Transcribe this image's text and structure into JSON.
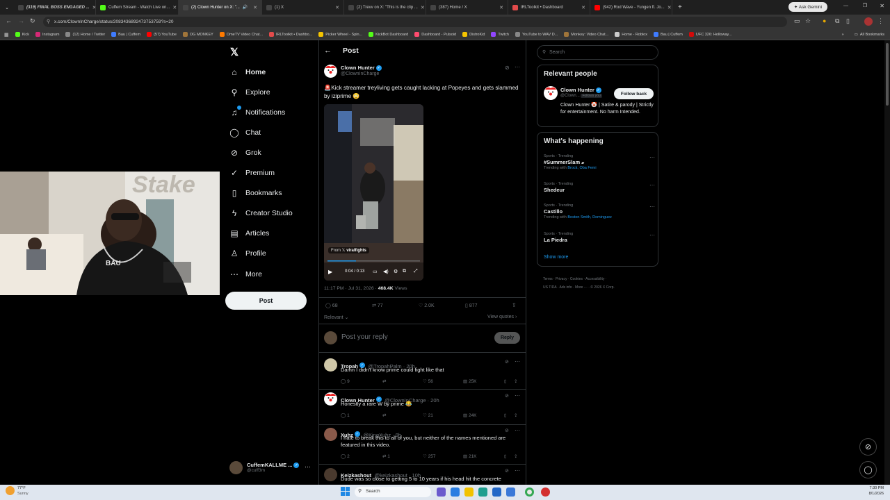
{
  "browser": {
    "tabs": [
      {
        "title": "(319) FINAL BOSS ENGAGED ...",
        "color": "#444"
      },
      {
        "title": "Cuffem Stream - Watch Live on...",
        "color": "#53fc18"
      },
      {
        "title": "(2) Clown Hunter on X: \"...",
        "color": "#444"
      },
      {
        "title": "(1) X",
        "color": "#444"
      },
      {
        "title": "(2) Trevv on X: \"This is the clip ...",
        "color": "#444"
      },
      {
        "title": "(387) Home / X",
        "color": "#444"
      },
      {
        "title": "IRLToolkit • Dashboard",
        "color": "#e34b4b"
      },
      {
        "title": "(942) Rod Wave - Yungen ft. Jo...",
        "color": "#ff0000"
      }
    ],
    "url": "x.com/ClownInCharge/status/2083436892473753759?s=20",
    "ask_gemini": "Ask Gemini",
    "bookmarks": [
      {
        "label": "Kick",
        "color": "#53fc18"
      },
      {
        "label": "Instagram",
        "color": "#d62976"
      },
      {
        "label": "(12) Home / Twitter",
        "color": "#888"
      },
      {
        "label": "Bau | Cuffem",
        "color": "#3f7cff"
      },
      {
        "label": "(57) YouTube",
        "color": "#ff0000"
      },
      {
        "label": "OG MONKEY",
        "color": "#a0753a"
      },
      {
        "label": "OmeTV Video Chat...",
        "color": "#ff7a00"
      },
      {
        "label": "IRLToolkit • Dashbo...",
        "color": "#e34b4b"
      },
      {
        "label": "Picker Wheel - Spin...",
        "color": "#f5c400"
      },
      {
        "label": "KickBot Dashboard",
        "color": "#53fc18"
      },
      {
        "label": "Dashboard - Pulsoid",
        "color": "#ff4b6e"
      },
      {
        "label": "DistroKid",
        "color": "#f5c400"
      },
      {
        "label": "Twitch",
        "color": "#9146ff"
      },
      {
        "label": "YouTube to WAV D...",
        "color": "#888"
      },
      {
        "label": "Monkey: Video Chat...",
        "color": "#a0753a"
      },
      {
        "label": "Home - Roblox",
        "color": "#ccc"
      },
      {
        "label": "Bau | Cuffem",
        "color": "#3f7cff"
      },
      {
        "label": "UFC 326: Holloway...",
        "color": "#d20a0a"
      }
    ],
    "all_bookmarks": "All Bookmarks"
  },
  "nav": {
    "items": [
      {
        "label": "Home",
        "icon": "home-icon"
      },
      {
        "label": "Explore",
        "icon": "search-icon"
      },
      {
        "label": "Notifications",
        "icon": "bell-icon"
      },
      {
        "label": "Chat",
        "icon": "chat-icon"
      },
      {
        "label": "Grok",
        "icon": "grok-icon"
      },
      {
        "label": "Premium",
        "icon": "premium-icon"
      },
      {
        "label": "Bookmarks",
        "icon": "bookmark-icon"
      },
      {
        "label": "Creator Studio",
        "icon": "lightning-icon"
      },
      {
        "label": "Articles",
        "icon": "article-icon"
      },
      {
        "label": "Profile",
        "icon": "person-icon"
      },
      {
        "label": "More",
        "icon": "more-icon"
      }
    ],
    "post_button": "Post",
    "account_name": "CuffemKALLME ...",
    "account_handle": "@cuff3m"
  },
  "post": {
    "header": "Post",
    "author_name": "Clown Hunter",
    "author_handle": "@ClownInCharge",
    "text": "🚨Kick streamer treyliving gets caught lacking at Popeyes and gets slammed by iziprime 😳",
    "video_source_prefix": "From",
    "video_source": "viralfights",
    "video_time": "0:04 / 0:13",
    "timestamp": "11:17 PM · Jul 31, 2026 ·",
    "views_count": "468.4K",
    "views_label": "Views",
    "replies": "68",
    "reposts": "77",
    "likes": "2.0K",
    "bookmarks": "877",
    "sort_label": "Relevant",
    "view_quotes": "View quotes",
    "reply_placeholder": "Post your reply",
    "reply_button": "Reply"
  },
  "replies": [
    {
      "name": "Tropah",
      "handle": "@TropahPalm · 20h",
      "text": "Damn I didn't know prime could fight like that",
      "replies": "9",
      "reposts": "",
      "likes": "56",
      "views": "25K"
    },
    {
      "name": "Clown Hunter",
      "handle": "@ClownInCharge · 20h",
      "text": "Honestly a rare W by prime 😂",
      "replies": "1",
      "reposts": "",
      "likes": "21",
      "views": "24K"
    },
    {
      "name": "Xuhz",
      "handle": "@KingXuhz · 9h",
      "text": "I hate to break this to all of you, but neither of the names mentioned are featured in this video.",
      "replies": "2",
      "reposts": "1",
      "likes": "257",
      "views": "21K"
    },
    {
      "name": "Keizkashout",
      "handle": "@keizkashout · 10h",
      "text": "Dude was so close to getting 5 to 10 years if his head hit the concrete",
      "replies": "",
      "reposts": "",
      "likes": "",
      "views": ""
    }
  ],
  "sidebar": {
    "search_placeholder": "Search",
    "relevant_title": "Relevant people",
    "person_name": "Clown Hunter",
    "person_handle": "@Clown...",
    "person_follows": "Follows you",
    "follow_back": "Follow back",
    "person_bio": "Clown Hunter 🤡 | Satire & parody | Strictly for entertainment. No harm Intended.",
    "happening_title": "What's happening",
    "trends": [
      {
        "category": "Sports · Trending",
        "topic": "#SummerSlam",
        "with_prefix": "Trending with",
        "with": "Brock, Oba Femi"
      },
      {
        "category": "Sports · Trending",
        "topic": "Shedeur",
        "with_prefix": "",
        "with": ""
      },
      {
        "category": "Sports · Trending",
        "topic": "Castillo",
        "with_prefix": "Trending with",
        "with": "Boston Smith, Dominguez"
      },
      {
        "category": "Sports · Trending",
        "topic": "La Piedra",
        "with_prefix": "",
        "with": ""
      }
    ],
    "show_more": "Show more",
    "footer_line1": "Terms · Privacy · Cookies · Accessibility ·",
    "footer_line2": "US TIDA · Ads info · More ··· · © 2026 X Corp."
  },
  "taskbar": {
    "weather_temp": "77°F",
    "weather_desc": "Sunny",
    "search": "Search",
    "time": "7:30 PM",
    "date": "8/1/2026"
  }
}
